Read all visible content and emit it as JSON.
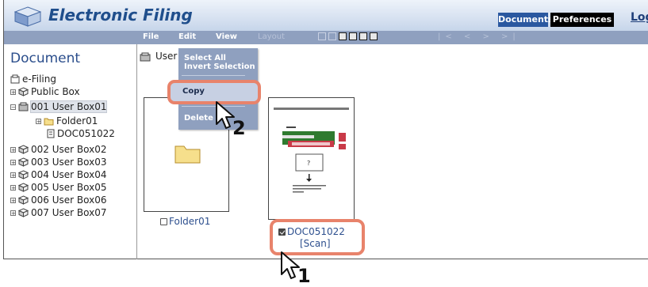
{
  "header": {
    "title": "Electronic Filing",
    "documents_button": "Documents",
    "preferences_button": "Preferences",
    "login_link": "Logi"
  },
  "menubar": {
    "file": "File",
    "edit": "Edit",
    "view": "View",
    "layout": "Layout",
    "pager": "|< < > >|"
  },
  "edit_menu": {
    "select_all": "Select All",
    "invert_selection": "Invert Selection",
    "copy": "Copy",
    "delete": "Delete"
  },
  "tree": {
    "title": "Document",
    "root": "e-Filing",
    "public_box": "Public Box",
    "user_box_01": "001 User Box01",
    "folder01": "Folder01",
    "doc": "DOC051022",
    "boxes": [
      "002 User Box02",
      "003 User Box03",
      "004 User Box04",
      "005 User Box05",
      "006 User Box06",
      "007 User Box07"
    ]
  },
  "main": {
    "breadcrumb": "User",
    "folder_label": "Folder01",
    "doc_label": "DOC051022",
    "doc_sublabel": "[Scan]",
    "folder_checked": false,
    "doc_checked": true
  },
  "steps": {
    "step1": "1",
    "step2": "2"
  },
  "colors": {
    "header_title": "#1f4e8c",
    "menubar": "#8fa0bf",
    "highlight": "#e8836b",
    "link": "#2d4f8e"
  }
}
